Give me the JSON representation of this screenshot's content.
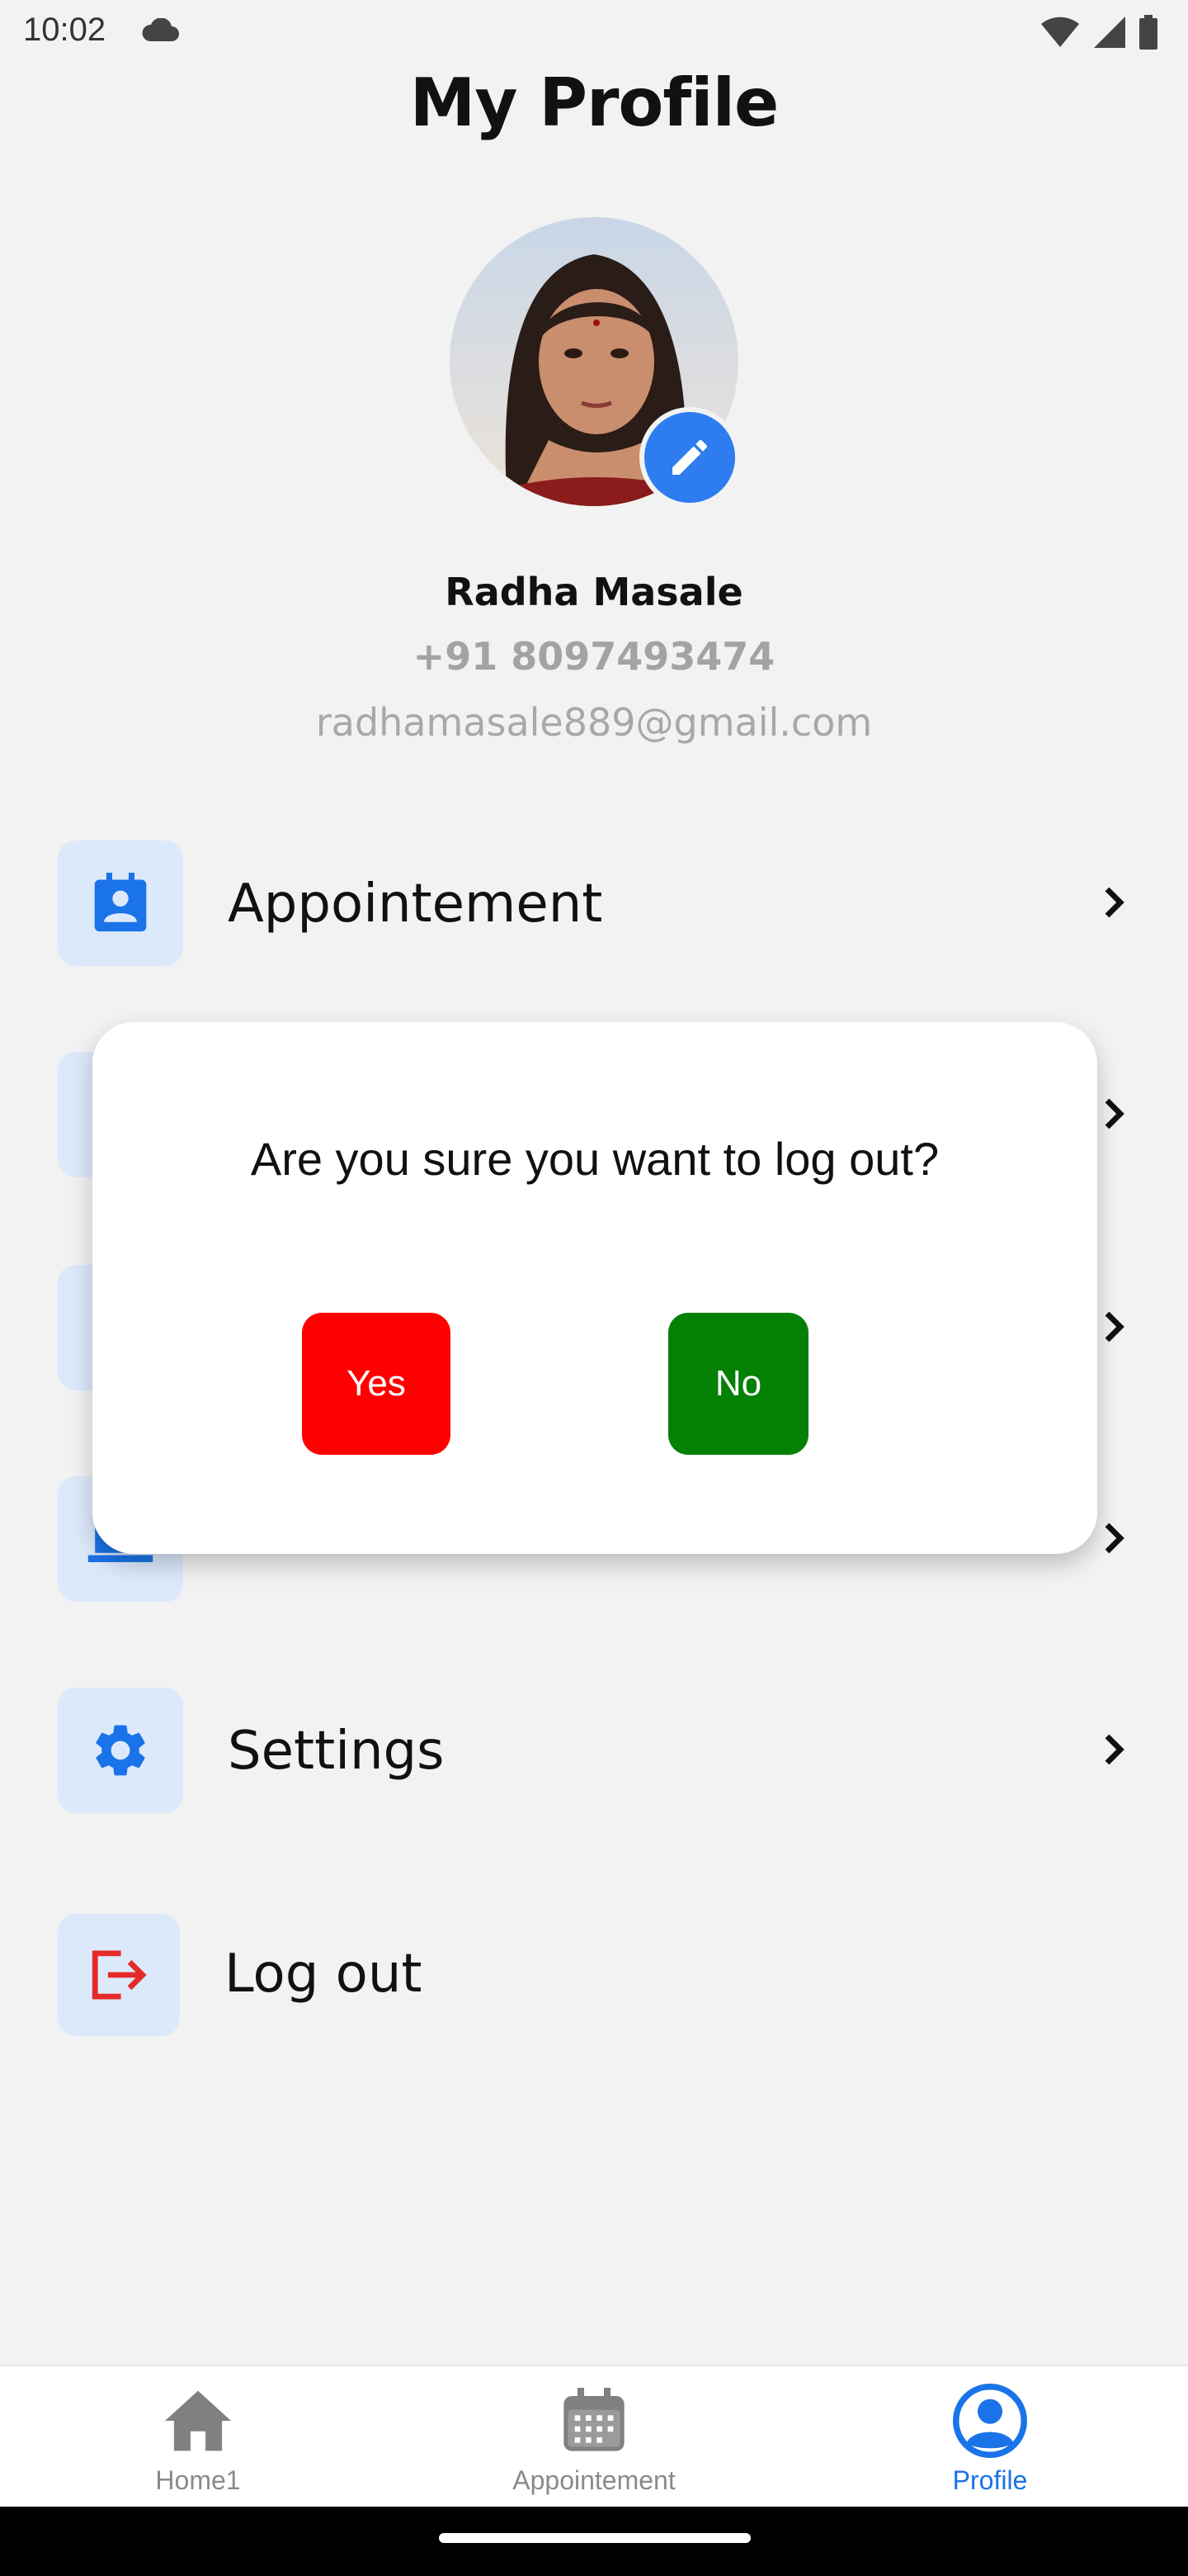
{
  "status_bar": {
    "time": "10:02"
  },
  "page": {
    "title": "My Profile"
  },
  "profile": {
    "name": "Radha Masale",
    "phone": "+91 8097493474",
    "email": "radhamasale889@gmail.com"
  },
  "menu": {
    "appointment_label": "Appointement",
    "settings_label": "Settings",
    "logout_label": "Log out"
  },
  "dialog": {
    "message": "Are you sure you want to log out?",
    "yes_label": "Yes",
    "no_label": "No"
  },
  "bottom_nav": {
    "items": [
      {
        "label": "Home1",
        "icon": "home-icon"
      },
      {
        "label": "Appointement",
        "icon": "calendar-icon"
      },
      {
        "label": "Profile",
        "icon": "profile-icon",
        "active": true
      }
    ]
  },
  "colors": {
    "accent": "#1a73e8",
    "icon_bg": "#dce9fb",
    "danger": "#fe0000",
    "success": "#048004",
    "logout_icon": "#e52a2a"
  }
}
